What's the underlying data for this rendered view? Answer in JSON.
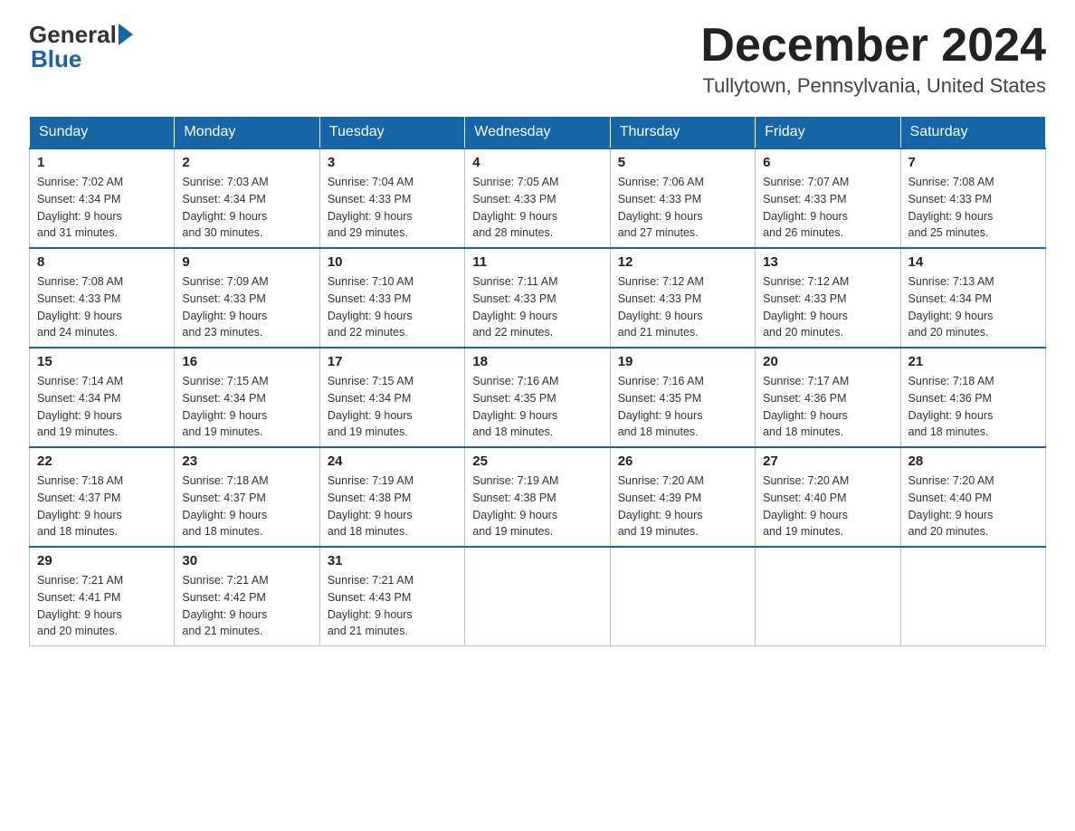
{
  "header": {
    "logo_general": "General",
    "logo_blue": "Blue",
    "month_title": "December 2024",
    "location": "Tullytown, Pennsylvania, United States"
  },
  "weekdays": [
    "Sunday",
    "Monday",
    "Tuesday",
    "Wednesday",
    "Thursday",
    "Friday",
    "Saturday"
  ],
  "weeks": [
    [
      {
        "day": "1",
        "sunrise": "7:02 AM",
        "sunset": "4:34 PM",
        "daylight": "9 hours and 31 minutes."
      },
      {
        "day": "2",
        "sunrise": "7:03 AM",
        "sunset": "4:34 PM",
        "daylight": "9 hours and 30 minutes."
      },
      {
        "day": "3",
        "sunrise": "7:04 AM",
        "sunset": "4:33 PM",
        "daylight": "9 hours and 29 minutes."
      },
      {
        "day": "4",
        "sunrise": "7:05 AM",
        "sunset": "4:33 PM",
        "daylight": "9 hours and 28 minutes."
      },
      {
        "day": "5",
        "sunrise": "7:06 AM",
        "sunset": "4:33 PM",
        "daylight": "9 hours and 27 minutes."
      },
      {
        "day": "6",
        "sunrise": "7:07 AM",
        "sunset": "4:33 PM",
        "daylight": "9 hours and 26 minutes."
      },
      {
        "day": "7",
        "sunrise": "7:08 AM",
        "sunset": "4:33 PM",
        "daylight": "9 hours and 25 minutes."
      }
    ],
    [
      {
        "day": "8",
        "sunrise": "7:08 AM",
        "sunset": "4:33 PM",
        "daylight": "9 hours and 24 minutes."
      },
      {
        "day": "9",
        "sunrise": "7:09 AM",
        "sunset": "4:33 PM",
        "daylight": "9 hours and 23 minutes."
      },
      {
        "day": "10",
        "sunrise": "7:10 AM",
        "sunset": "4:33 PM",
        "daylight": "9 hours and 22 minutes."
      },
      {
        "day": "11",
        "sunrise": "7:11 AM",
        "sunset": "4:33 PM",
        "daylight": "9 hours and 22 minutes."
      },
      {
        "day": "12",
        "sunrise": "7:12 AM",
        "sunset": "4:33 PM",
        "daylight": "9 hours and 21 minutes."
      },
      {
        "day": "13",
        "sunrise": "7:12 AM",
        "sunset": "4:33 PM",
        "daylight": "9 hours and 20 minutes."
      },
      {
        "day": "14",
        "sunrise": "7:13 AM",
        "sunset": "4:34 PM",
        "daylight": "9 hours and 20 minutes."
      }
    ],
    [
      {
        "day": "15",
        "sunrise": "7:14 AM",
        "sunset": "4:34 PM",
        "daylight": "9 hours and 19 minutes."
      },
      {
        "day": "16",
        "sunrise": "7:15 AM",
        "sunset": "4:34 PM",
        "daylight": "9 hours and 19 minutes."
      },
      {
        "day": "17",
        "sunrise": "7:15 AM",
        "sunset": "4:34 PM",
        "daylight": "9 hours and 19 minutes."
      },
      {
        "day": "18",
        "sunrise": "7:16 AM",
        "sunset": "4:35 PM",
        "daylight": "9 hours and 18 minutes."
      },
      {
        "day": "19",
        "sunrise": "7:16 AM",
        "sunset": "4:35 PM",
        "daylight": "9 hours and 18 minutes."
      },
      {
        "day": "20",
        "sunrise": "7:17 AM",
        "sunset": "4:36 PM",
        "daylight": "9 hours and 18 minutes."
      },
      {
        "day": "21",
        "sunrise": "7:18 AM",
        "sunset": "4:36 PM",
        "daylight": "9 hours and 18 minutes."
      }
    ],
    [
      {
        "day": "22",
        "sunrise": "7:18 AM",
        "sunset": "4:37 PM",
        "daylight": "9 hours and 18 minutes."
      },
      {
        "day": "23",
        "sunrise": "7:18 AM",
        "sunset": "4:37 PM",
        "daylight": "9 hours and 18 minutes."
      },
      {
        "day": "24",
        "sunrise": "7:19 AM",
        "sunset": "4:38 PM",
        "daylight": "9 hours and 18 minutes."
      },
      {
        "day": "25",
        "sunrise": "7:19 AM",
        "sunset": "4:38 PM",
        "daylight": "9 hours and 19 minutes."
      },
      {
        "day": "26",
        "sunrise": "7:20 AM",
        "sunset": "4:39 PM",
        "daylight": "9 hours and 19 minutes."
      },
      {
        "day": "27",
        "sunrise": "7:20 AM",
        "sunset": "4:40 PM",
        "daylight": "9 hours and 19 minutes."
      },
      {
        "day": "28",
        "sunrise": "7:20 AM",
        "sunset": "4:40 PM",
        "daylight": "9 hours and 20 minutes."
      }
    ],
    [
      {
        "day": "29",
        "sunrise": "7:21 AM",
        "sunset": "4:41 PM",
        "daylight": "9 hours and 20 minutes."
      },
      {
        "day": "30",
        "sunrise": "7:21 AM",
        "sunset": "4:42 PM",
        "daylight": "9 hours and 21 minutes."
      },
      {
        "day": "31",
        "sunrise": "7:21 AM",
        "sunset": "4:43 PM",
        "daylight": "9 hours and 21 minutes."
      },
      null,
      null,
      null,
      null
    ]
  ],
  "labels": {
    "sunrise": "Sunrise:",
    "sunset": "Sunset:",
    "daylight": "Daylight: 9 hours"
  }
}
